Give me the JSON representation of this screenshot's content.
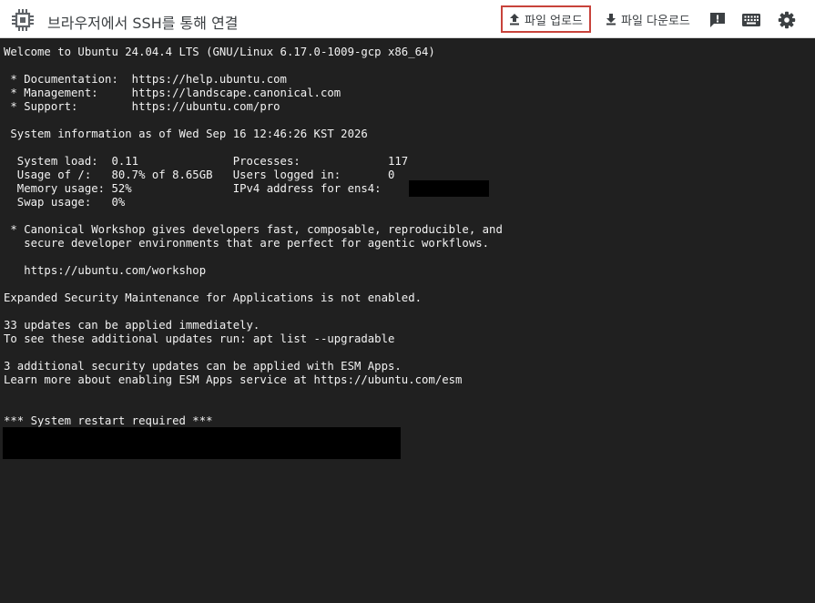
{
  "header": {
    "title": "브라우저에서 SSH를 통해 연결",
    "upload_label": "파일 업로드",
    "download_label": "파일 다운로드"
  },
  "icons": {
    "app": "chip-icon",
    "upload": "upload-icon",
    "download": "download-icon",
    "feedback": "feedback-icon",
    "keyboard": "keyboard-icon",
    "settings": "gear-icon"
  },
  "colors": {
    "terminal_bg": "#202020",
    "terminal_fg": "#f2f2f2",
    "highlight_border": "#c8433b"
  },
  "terminal": {
    "lines": [
      "Welcome to Ubuntu 24.04.4 LTS (GNU/Linux 6.17.0-1009-gcp x86_64)",
      " * Documentation:  https://help.ubuntu.com",
      " * Management:     https://landscape.canonical.com",
      " * Support:        https://ubuntu.com/pro",
      " System information as of Wed Sep 16 12:46:26 KST 2026",
      "  System load:  0.11              Processes:             117",
      "  Usage of /:   80.7% of 8.65GB   Users logged in:       0",
      "  Memory usage: 52%               IPv4 address for ens4: ",
      "  Swap usage:   0%",
      " * Canonical Workshop gives developers fast, composable, reproducible, and",
      "   secure developer environments that are perfect for agentic workflows.",
      "   https://ubuntu.com/workshop",
      "Expanded Security Maintenance for Applications is not enabled.",
      "33 updates can be applied immediately.",
      "To see these additional updates run: apt list --upgradable",
      "3 additional security updates can be applied with ESM Apps.",
      "Learn more about enabling ESM Apps service at https://ubuntu.com/esm",
      "*** System restart required ***"
    ]
  }
}
